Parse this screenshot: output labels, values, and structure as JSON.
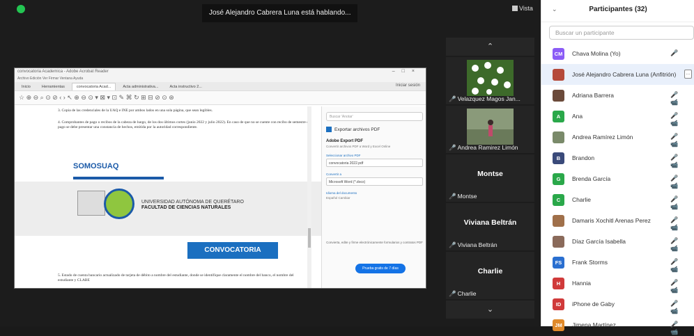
{
  "top": {
    "speaking_banner": "José Alejandro Cabrera Luna está hablando...",
    "view_label": "Vista"
  },
  "share": {
    "window_title": "convocatoria Academica - Adobe Acrobat Reader",
    "menu": "Archivo  Edición  Ver  Firmar  Ventana  Ayuda",
    "tabs": [
      "Inicio",
      "Herramientas",
      "convocatoria Acad...",
      "Acta administrativa...",
      "Acta instructivo 2..."
    ],
    "signin": "Iniciar sesión",
    "toolbar_icons": "☆ ⊕ ⊖ ⌕ ⊙ ⊘ ‹ › ↖ ⊕ ⊖ ⊙ ▾ ⊠ ▾ ⊡ ✎ ⌘ ↻ ⊞ ⊟ ⊘ ⊙ ⊛",
    "doc_p1": "3. Copia de las credenciales de la UAQ e INE por ambos lados en una sola página, que sean legibles.",
    "doc_p2": "4. Comprobantes de pago o recibos de la cabeza de luego, de los dos últimos cortes (junio 2022 y julio 2022). En caso de que no se cuente con recibo de semestre o pago se debe presentar una constancia de hechos, emitida por la autoridad correspondiente.",
    "somos": "SOMOSUAQ",
    "uni_line1": "UNIVERSIDAD AUTÓNOMA DE QUERÉTARO",
    "uni_line2": "FACULTAD DE CIENCIAS NATURALES",
    "convocatoria": "CONVOCATORIA",
    "doc_p3": "5. Estado de cuenta bancario actualizado de tarjeta de débito a nombre del estudiante, donde se identifique claramente el nombre del banco, el nombre del estudiante y CLABE",
    "panel": {
      "search": "Buscar 'Anotar'",
      "export": "Exportar archivos PDF",
      "heading": "Adobe Export PDF",
      "sub": "Convertir archivos PDF a Word y Excel Online",
      "select_label": "Seleccionar archivo PDF",
      "select_value": "convocatoria 2022.pdf",
      "convert_label": "Convertir a",
      "convert_value": "Microsoft Word (*.docx)",
      "lang_label": "Idioma del documento",
      "lang_value": "Español Cambiar",
      "footer": "Convierta, edite y firme electrónicamente formularios y contratos PDF",
      "trial": "Prueba gratis de 7 días"
    }
  },
  "strip": {
    "up": "⌃",
    "down": "⌄",
    "tiles": [
      {
        "name": "Velazquez Magos Jan..."
      },
      {
        "name": "Andrea Ramirez Limón"
      },
      {
        "big": "Montse",
        "name": "Montse"
      },
      {
        "big": "Viviana Beltrán",
        "name": "Viviana Beltrán"
      },
      {
        "big": "Charlie",
        "name": "Charlie"
      }
    ]
  },
  "participants": {
    "title": "Participantes (32)",
    "search_placeholder": "Buscar un participante",
    "list": [
      {
        "initials": "CM",
        "color": "#8b5cf6",
        "name": "Chava Molina (Yo)",
        "icons": "🎤"
      },
      {
        "initials": "",
        "color": "#b54a3a",
        "name": "José Alejandro Cabrera Luna (Anfitrión)",
        "icons": "",
        "selected": true
      },
      {
        "initials": "",
        "color": "#6b4a3a",
        "name": "Adriana Barrera",
        "icons": "🎤 📹"
      },
      {
        "initials": "A",
        "color": "#2aa84a",
        "name": "Ana",
        "icons": "🎤 📹"
      },
      {
        "initials": "",
        "color": "#7a8a6a",
        "name": "Andrea Ramírez Limón",
        "icons": "🎤 📹"
      },
      {
        "initials": "B",
        "color": "#3a4a7a",
        "name": "Brandon",
        "icons": "🎤 📹"
      },
      {
        "initials": "G",
        "color": "#2aa84a",
        "name": "Brenda García",
        "icons": "🎤 📹"
      },
      {
        "initials": "C",
        "color": "#2aa84a",
        "name": "Charlie",
        "icons": "🎤 📹"
      },
      {
        "initials": "",
        "color": "#a0704a",
        "name": "Damaris Xochitl Arenas Perez",
        "icons": "🎤 📹"
      },
      {
        "initials": "",
        "color": "#8a6a5a",
        "name": "Díaz García Isabella",
        "icons": "🎤 📹"
      },
      {
        "initials": "FS",
        "color": "#2a6fd0",
        "name": "Frank Storms",
        "icons": "🎤 📹"
      },
      {
        "initials": "H",
        "color": "#d03a3a",
        "name": "Hannia",
        "icons": "🎤 📹"
      },
      {
        "initials": "ID",
        "color": "#d03a3a",
        "name": "iPhone de Gaby",
        "icons": "🎤 📹"
      },
      {
        "initials": "JM",
        "color": "#e08a2a",
        "name": "Jimena Martínez",
        "icons": "🎤 📹"
      }
    ]
  }
}
